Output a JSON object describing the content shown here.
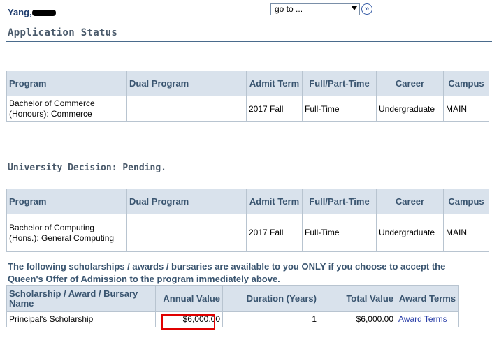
{
  "header": {
    "student_name": "Yang,",
    "page_title": "Application Status",
    "goto_select": "go to ...",
    "goto_button": "»"
  },
  "columns": {
    "program": "Program",
    "dual_program": "Dual Program",
    "admit_term": "Admit Term",
    "full_part_time": "Full/Part-Time",
    "career": "Career",
    "campus": "Campus"
  },
  "application": {
    "program": "Bachelor of Commerce (Honours): Commerce",
    "dual_program": "",
    "admit_term": "2017 Fall",
    "full_part_time": "Full-Time",
    "career": "Undergraduate",
    "campus": "MAIN"
  },
  "decision": {
    "heading": "University Decision: Pending.",
    "program": "Bachelor of Computing (Hons.): General Computing",
    "dual_program": "",
    "admit_term": "2017 Fall",
    "full_part_time": "Full-Time",
    "career": "Undergraduate",
    "campus": "MAIN"
  },
  "scholarships": {
    "notice": "The following scholarships / awards / bursaries are available to you ONLY if you choose to accept the Queen's Offer of Admission to the program immediately above.",
    "col_name": "Scholarship / Award / Bursary Name",
    "col_annual": "Annual Value",
    "col_duration": "Duration (Years)",
    "col_total": "Total Value",
    "col_terms": "Award Terms",
    "rows": [
      {
        "name": "Principal's Scholarship",
        "annual": "$6,000.00",
        "duration": "1",
        "total": "$6,000.00",
        "terms_link": "Award Terms"
      }
    ]
  },
  "colors": {
    "header_bg": "#d9e2ec",
    "header_text": "#3a5570",
    "highlight": "#e00000",
    "link": "#2a3fa8"
  }
}
